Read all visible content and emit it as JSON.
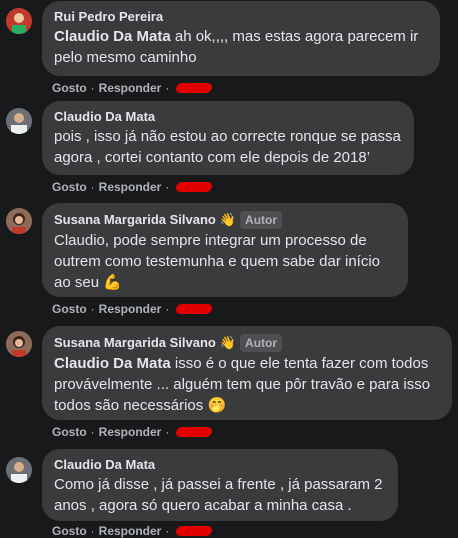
{
  "comments": [
    {
      "author": "Rui Pedro Pereira",
      "mention": "Claudio Da Mata",
      "text": " ah ok,,,, mas estas agora parecem ir pelo mesmo caminho",
      "like": "Gosto",
      "reply": "Responder"
    },
    {
      "author": "Claudio Da Mata",
      "text": "pois , isso já não estou ao correcte ronque se passa agora , cortei contanto com ele depois de 2018’",
      "like": "Gosto",
      "reply": "Responder"
    },
    {
      "author": "Susana Margarida Silvano",
      "badge": "Autor",
      "text": "Claudio, pode sempre integrar um processo de outrem como testemunha e quem sabe dar início ao seu",
      "emoji": "💪",
      "like": "Gosto",
      "reply": "Responder"
    },
    {
      "author": "Susana Margarida Silvano",
      "badge": "Autor",
      "mention": "Claudio Da Mata",
      "text": " isso é o que ele tenta fazer com todos provávelmente ... alguém tem que pôr travão e para isso todos são necessários",
      "emoji": "🤭",
      "like": "Gosto",
      "reply": "Responder"
    },
    {
      "author": "Claudio Da Mata",
      "text": "Como já disse , já passei a frente , já passaram 2 anos , agora só quero acabar a minha casa .",
      "like": "Gosto",
      "reply": "Responder"
    }
  ],
  "separator": "·",
  "wave_icon": "👋",
  "colors": {
    "bubble": "#3a3b3c",
    "background": "#18191a",
    "redaction": "#e00000"
  }
}
